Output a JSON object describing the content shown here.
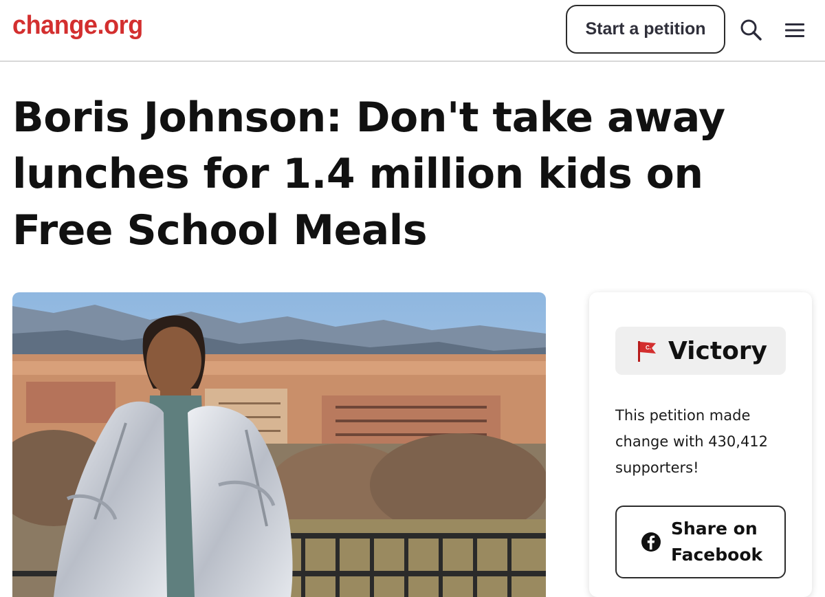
{
  "header": {
    "logo": "change.org",
    "start_button": "Start a petition",
    "search_icon": "search-icon",
    "menu_icon": "hamburger-menu-icon",
    "brand_color": "#d32f2f"
  },
  "petition": {
    "title": "Boris Johnson: Don't take away lunches for 1.4 million kids on Free School Meals"
  },
  "status_card": {
    "badge_icon": "victory-flag-icon",
    "badge_label": "Victory",
    "description": "This petition made change with 430,412 supporters!",
    "share_icon": "facebook-icon",
    "share_label": "Share on Facebook"
  }
}
